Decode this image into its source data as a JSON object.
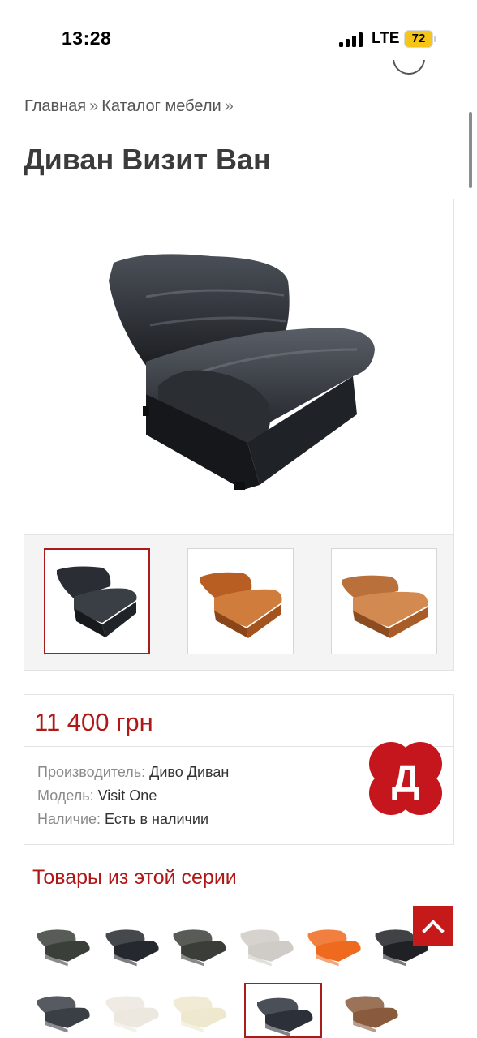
{
  "status": {
    "time": "13:28",
    "network": "LTE",
    "battery": "72"
  },
  "breadcrumb": {
    "items": [
      "Главная",
      "Каталог мебели"
    ],
    "separator": "»"
  },
  "product": {
    "title": "Диван Визит Ван",
    "price": "11 400 грн",
    "specs": [
      {
        "label": "Производитель:",
        "value": "Диво Диван"
      },
      {
        "label": "Модель:",
        "value": "Visit One"
      },
      {
        "label": "Наличие:",
        "value": "Есть в наличии"
      }
    ],
    "brand_logo_letter": "Д"
  },
  "gallery": {
    "main_image": "black-leather-sofa",
    "thumbnails": [
      {
        "color": "#2a2d33",
        "active": true
      },
      {
        "color": "#c56a2a",
        "active": false
      },
      {
        "color": "#c2763a",
        "active": false
      }
    ]
  },
  "series": {
    "title": "Товары из этой серии",
    "items": [
      {
        "color": "#3a3f3a",
        "active": false
      },
      {
        "color": "#25282e",
        "active": false
      },
      {
        "color": "#3b3e38",
        "active": false
      },
      {
        "color": "#cfcbc6",
        "active": false
      },
      {
        "color": "#ee6a1e",
        "active": false
      },
      {
        "color": "#1f2124",
        "active": false
      },
      {
        "color": "#3a3e45",
        "active": false
      },
      {
        "color": "#ece8df",
        "active": false
      },
      {
        "color": "#eee8cf",
        "active": false
      },
      {
        "color": "#2c3039",
        "active": true
      },
      {
        "color": "#8a5a3c",
        "active": false
      }
    ]
  },
  "colors": {
    "accent": "#b01818",
    "button": "#c61a1a"
  }
}
